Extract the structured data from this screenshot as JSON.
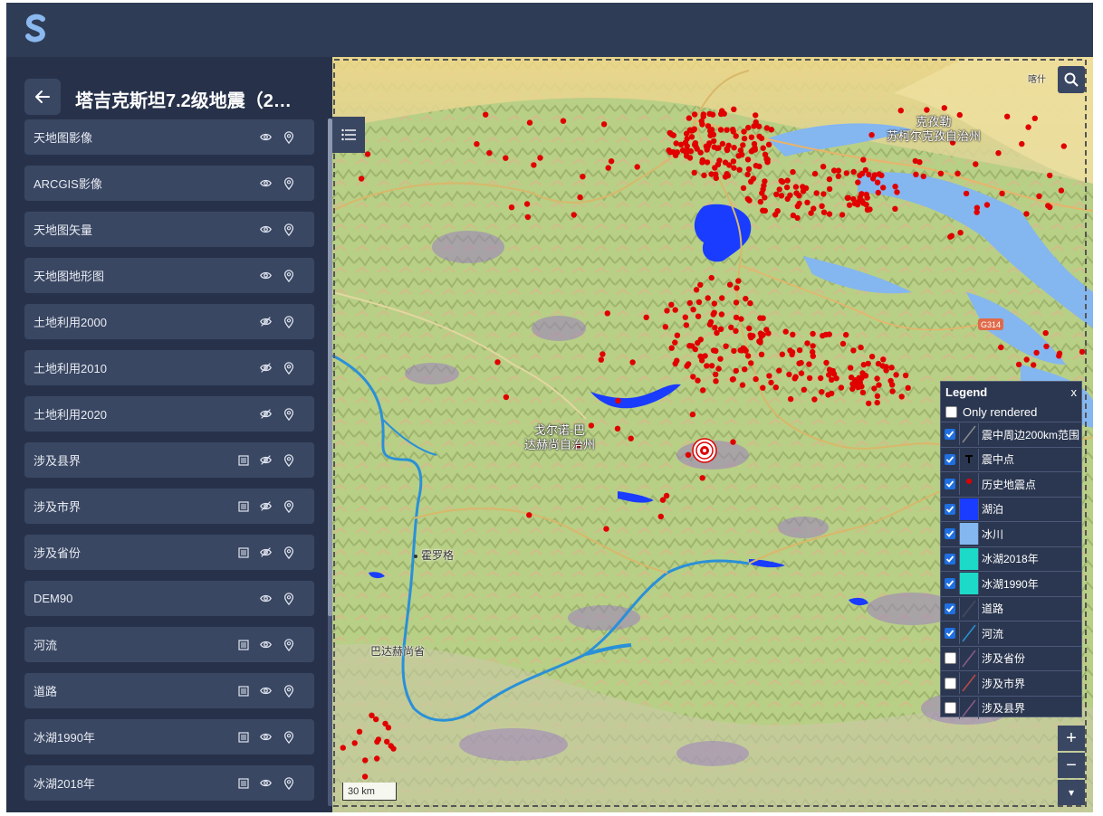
{
  "app": {
    "logo_icon": "s-logo-icon"
  },
  "sidebar": {
    "back_icon": "arrow-left-icon",
    "title": "塔吉克斯坦7.2级地震（2…",
    "layers": [
      {
        "label": "天地图影像",
        "attr_table": false,
        "visible": true
      },
      {
        "label": "ARCGIS影像",
        "attr_table": false,
        "visible": true
      },
      {
        "label": "天地图矢量",
        "attr_table": false,
        "visible": true
      },
      {
        "label": "天地图地形图",
        "attr_table": false,
        "visible": true
      },
      {
        "label": "土地利用2000",
        "attr_table": false,
        "visible": false
      },
      {
        "label": "土地利用2010",
        "attr_table": false,
        "visible": false
      },
      {
        "label": "土地利用2020",
        "attr_table": false,
        "visible": false
      },
      {
        "label": "涉及县界",
        "attr_table": true,
        "visible": false
      },
      {
        "label": "涉及市界",
        "attr_table": true,
        "visible": false
      },
      {
        "label": "涉及省份",
        "attr_table": true,
        "visible": false
      },
      {
        "label": "DEM90",
        "attr_table": false,
        "visible": true
      },
      {
        "label": "河流",
        "attr_table": true,
        "visible": true
      },
      {
        "label": "道路",
        "attr_table": true,
        "visible": true
      },
      {
        "label": "冰湖1990年",
        "attr_table": true,
        "visible": true
      },
      {
        "label": "冰湖2018年",
        "attr_table": true,
        "visible": true
      }
    ]
  },
  "map": {
    "labels": {
      "kizilsu": "克孜勒\n苏柯尔克孜自治州",
      "gorno": "戈尔诺-巴\n达赫尚自治州",
      "khorog": "霍罗格",
      "badakhshan": "巴达赫尚省",
      "kashgar": "喀什",
      "road_g314": "G314"
    },
    "scale_text": "30 km",
    "colors": {
      "lake": "#1a3cff",
      "glacier": "#84b6f0",
      "glacial_lake": "#1cd9c8",
      "river": "#2a90d8",
      "quake_point": "#e00000",
      "county_border": "#d0c070"
    }
  },
  "legend": {
    "title": "Legend",
    "close": "x",
    "only_rendered_label": "Only rendered",
    "items": [
      {
        "label": "震中周边200km范围",
        "checked": true,
        "swatch": "line-gray"
      },
      {
        "label": "震中点",
        "checked": true,
        "swatch": "epicenter"
      },
      {
        "label": "历史地震点",
        "checked": true,
        "swatch": "dot-red"
      },
      {
        "label": "湖泊",
        "checked": true,
        "swatch": "fill-blue"
      },
      {
        "label": "冰川",
        "checked": true,
        "swatch": "fill-lightblue"
      },
      {
        "label": "冰湖2018年",
        "checked": true,
        "swatch": "fill-teal"
      },
      {
        "label": "冰湖1990年",
        "checked": true,
        "swatch": "fill-teal"
      },
      {
        "label": "道路",
        "checked": true,
        "swatch": "line-dark"
      },
      {
        "label": "河流",
        "checked": true,
        "swatch": "line-blue"
      },
      {
        "label": "涉及省份",
        "checked": false,
        "swatch": "line-purple"
      },
      {
        "label": "涉及市界",
        "checked": false,
        "swatch": "line-red"
      },
      {
        "label": "涉及县界",
        "checked": false,
        "swatch": "line-purple"
      }
    ]
  },
  "controls": {
    "zoom_in": "+",
    "zoom_out": "−",
    "zoom_down": "▾",
    "layers_toggle_icon": "list-icon",
    "search_icon": "search-icon"
  }
}
